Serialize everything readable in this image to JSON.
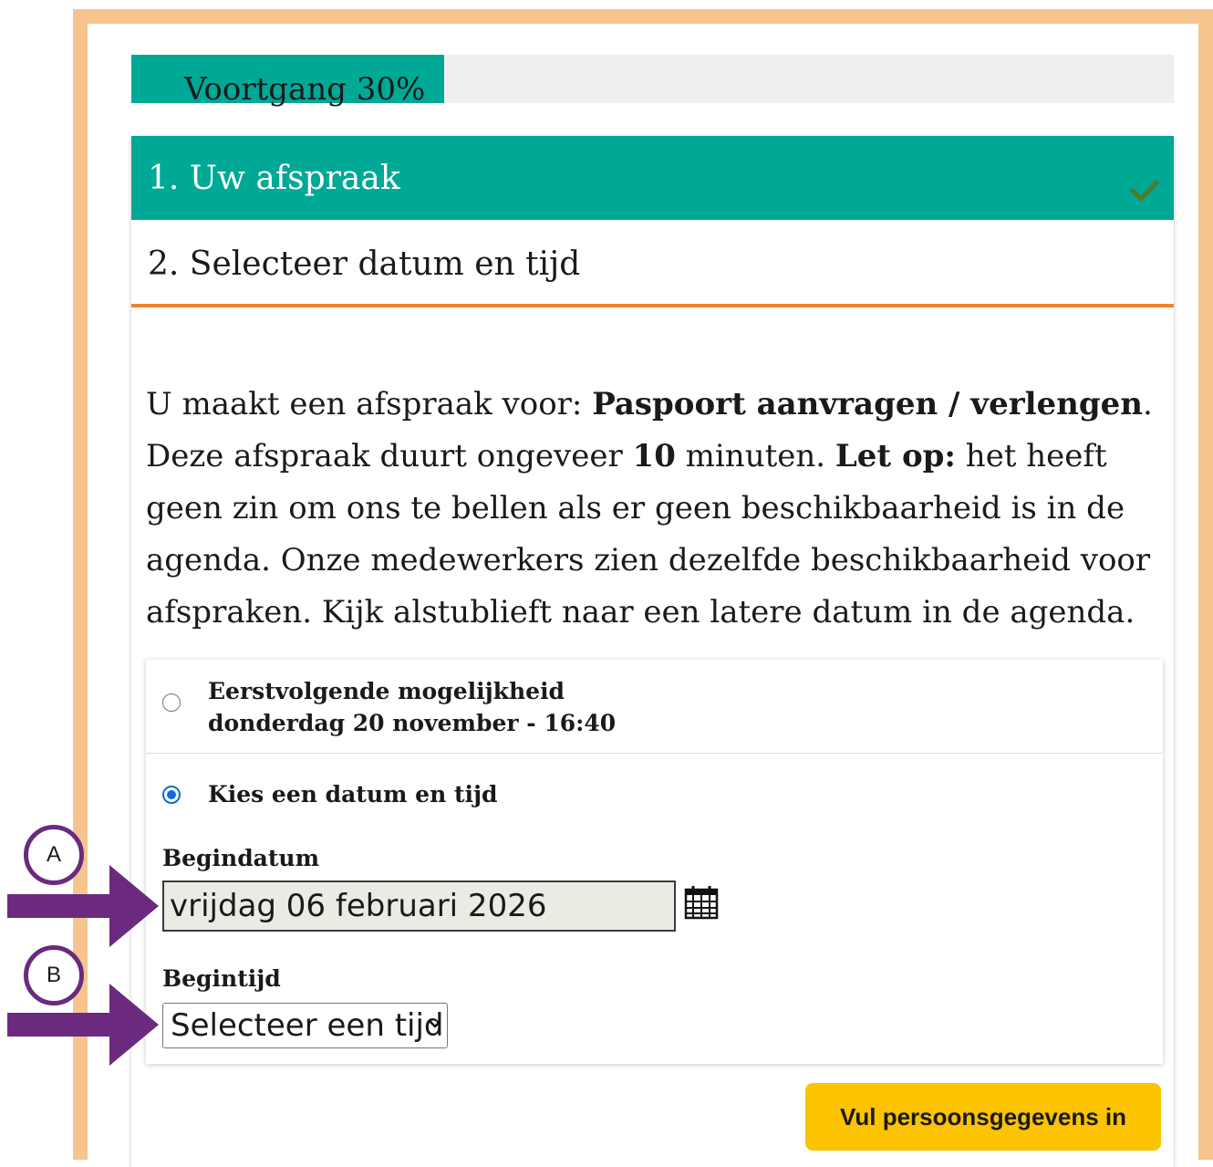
{
  "colors": {
    "frame": "#f5c48f",
    "accent": "#00a896",
    "step_underline": "#f0822a",
    "radio_selected": "#0b6bde",
    "cta": "#fcc300",
    "annotation": "#6b2a7e"
  },
  "progress": {
    "label": "Voortgang 30%",
    "value": 0.3
  },
  "steps": [
    {
      "label": "1. Uw afspraak",
      "completed": true,
      "icon": "check-icon"
    },
    {
      "label": "2. Selecteer datum en tijd",
      "active": true
    }
  ],
  "intro": {
    "t1": "U maakt een afspraak voor: ",
    "service": "Paspoort aanvragen / verlengen",
    "t2": ". Deze afspraak duurt ongeveer ",
    "minutes": "10",
    "t3": " minuten. ",
    "warning_label": "Let op:",
    "t4": " het heeft geen zin om ons te bellen als er geen beschikbaarheid is in de agenda. Onze medewerkers zien dezelfde beschikbaarheid voor afspraken. Kijk alstublieft naar een latere datum in de agenda."
  },
  "options": {
    "first_available": {
      "title": "Eerstvolgende mogelijkheid",
      "datetime": "donderdag 20 november - 16:40",
      "selected": false
    },
    "choose": {
      "title": "Kies een datum en tijd",
      "selected": true
    }
  },
  "start_date": {
    "label": "Begindatum",
    "value": "vrijdag 06 februari 2026",
    "icon": "calendar-icon"
  },
  "start_time": {
    "label": "Begintijd",
    "selected": "Selecteer een tijd",
    "icon": "chevron-down-icon"
  },
  "cta": {
    "label": "Vul persoonsgegevens in"
  },
  "annotations": [
    {
      "label": "A",
      "target": "start_date"
    },
    {
      "label": "B",
      "target": "start_time"
    }
  ]
}
